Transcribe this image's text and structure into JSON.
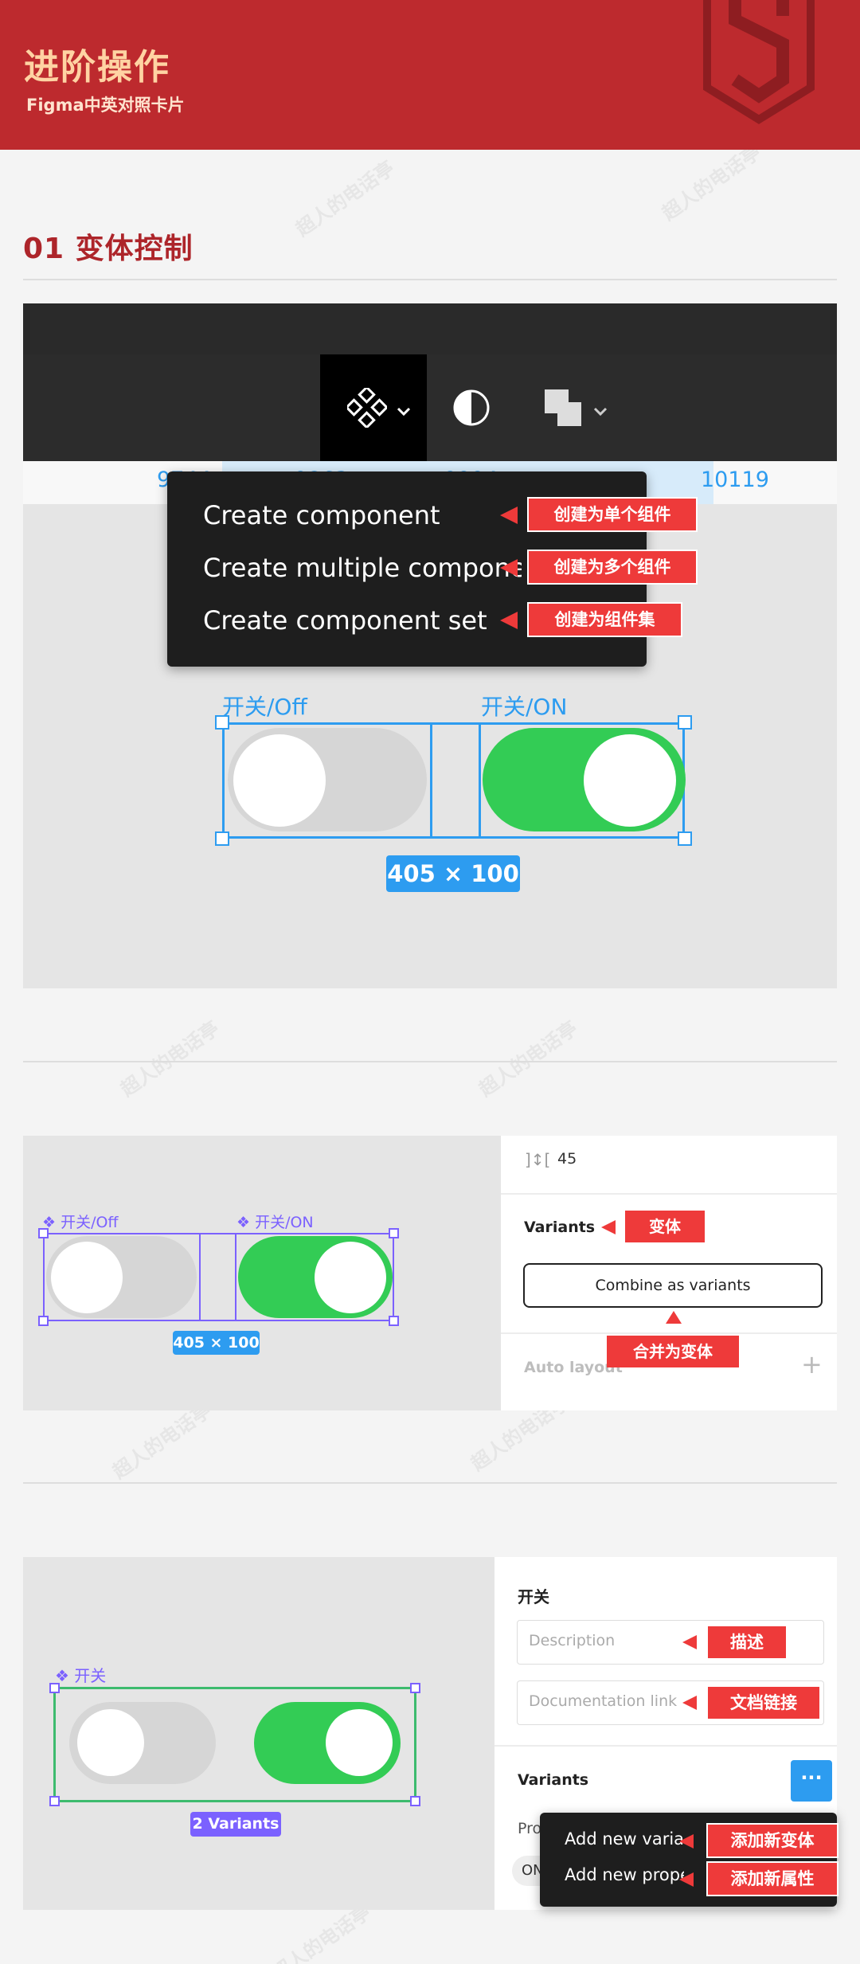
{
  "header": {
    "title": "进阶操作",
    "subtitle": "Figma中英对照卡片"
  },
  "section1": {
    "title": "01 变体控制",
    "ruler_values": [
      "9744",
      "9863",
      "9994",
      "10119"
    ],
    "menu_items": [
      "Create component",
      "Create multiple components",
      "Create component set"
    ],
    "tags": [
      "创建为单个组件",
      "创建为多个组件",
      "创建为组件集"
    ],
    "label_off": "开关/Off",
    "label_on": "开关/ON",
    "dimension": "405 × 100"
  },
  "section2": {
    "label_off": "开关/Off",
    "label_on": "开关/ON",
    "dimension": "405 × 100",
    "spacing_value": "45",
    "variants_label": "Variants",
    "variants_tag": "变体",
    "combine_button": "Combine as variants",
    "combine_tag": "合并为变体",
    "auto_layout_label": "Auto layout",
    "add_icon": "+"
  },
  "section3": {
    "component_label": "开关",
    "variants_badge": "2 Variants",
    "panel_title": "开关",
    "description_placeholder": "Description",
    "description_tag": "描述",
    "doc_link_placeholder": "Documentation link",
    "doc_link_tag": "文档链接",
    "variants_label": "Variants",
    "more_icon": "···",
    "property_label": "Property",
    "value_chip": "ON",
    "menu_items": [
      "Add new variant",
      "Add new property"
    ],
    "menu_tags": [
      "添加新变体",
      "添加新属性"
    ]
  },
  "watermark": "超人的电话亭",
  "colors": {
    "header": "#bd2a2e",
    "title": "#ad252a",
    "tag": "#ee3a3a",
    "selection": "#2d9cf0",
    "toggle_on": "#33cc55",
    "component": "#7b61ff",
    "component_set": "#3dbb6e"
  }
}
